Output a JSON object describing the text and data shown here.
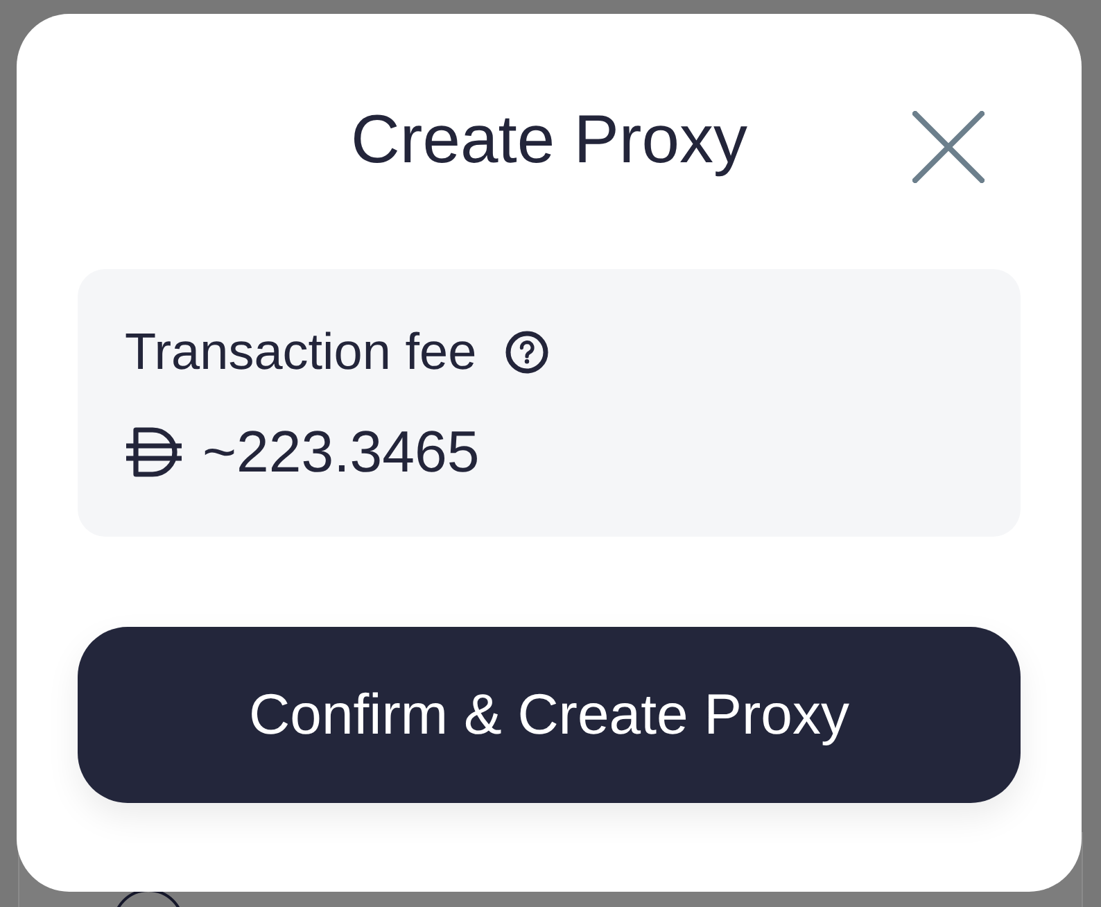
{
  "modal": {
    "title": "Create Proxy",
    "fee": {
      "label": "Transaction fee",
      "value": "~223.3465"
    },
    "confirm_button": "Confirm & Create Proxy"
  }
}
